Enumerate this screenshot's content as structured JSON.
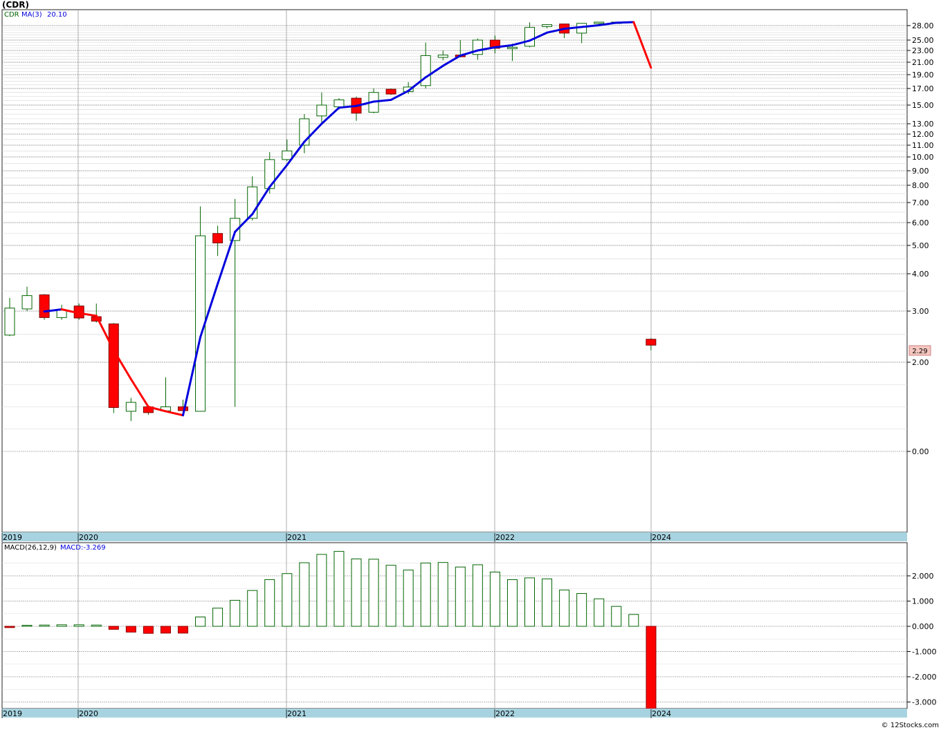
{
  "symbol_label": "(CDR)",
  "price_panel": {
    "legend_symbol": "CDR",
    "legend_ma": "MA(3)",
    "legend_ma_value": "20.10",
    "last_price_tag": "2.29"
  },
  "macd_panel": {
    "legend_label": "MACD(26,12,9)",
    "legend_value": "MACD:-3.269"
  },
  "footer": {
    "copyright": "© 12Stocks.com"
  },
  "colors": {
    "up_candle": "#ffffff",
    "up_outline": "#006400",
    "down_candle": "#ff0000",
    "ma_line": "#0000dd",
    "ma_down": "#ff0000",
    "date_bar": "#a7d3e0",
    "grid": "#aaaaaa",
    "price_tag_bg": "#f4c7c0"
  },
  "chart_data": [
    {
      "type": "candlestick",
      "title": "",
      "y_scale": "log",
      "y_ticks": [
        "28.00",
        "25.00",
        "23.00",
        "21.00",
        "19.00",
        "17.00",
        "15.00",
        "13.00",
        "12.00",
        "11.00",
        "10.00",
        "9.00",
        "8.00",
        "7.00",
        "6.00",
        "5.00",
        "4.00",
        "3.00",
        "2.00",
        "0.00"
      ],
      "x_ticks": [
        "2019",
        "2020",
        "2021",
        "2022",
        "2024"
      ],
      "grid": true,
      "legend_position": "top-left",
      "candles": [
        {
          "o": 2.48,
          "h": 3.32,
          "l": 2.46,
          "c": 3.07
        },
        {
          "o": 3.05,
          "h": 3.62,
          "l": 3.0,
          "c": 3.38
        },
        {
          "o": 3.4,
          "h": 3.42,
          "l": 2.8,
          "c": 2.85
        },
        {
          "o": 2.85,
          "h": 3.15,
          "l": 2.8,
          "c": 3.02
        },
        {
          "o": 3.12,
          "h": 3.18,
          "l": 2.8,
          "c": 2.84
        },
        {
          "o": 2.87,
          "h": 3.18,
          "l": 2.74,
          "c": 2.77
        },
        {
          "o": 2.71,
          "h": 2.73,
          "l": 0.86,
          "c": 0.985
        },
        {
          "o": 0.9,
          "h": 1.2,
          "l": 0.68,
          "c": 1.1
        },
        {
          "o": 1.0,
          "h": 1.0,
          "l": 0.82,
          "c": 0.87
        },
        {
          "o": 0.91,
          "h": 1.66,
          "l": 0.89,
          "c": 1.0
        },
        {
          "o": 1.0,
          "h": 1.16,
          "l": 0.88,
          "c": 0.915
        },
        {
          "o": 0.9,
          "h": 6.8,
          "l": 0.895,
          "c": 5.4
        },
        {
          "o": 5.5,
          "h": 5.85,
          "l": 4.6,
          "c": 5.1
        },
        {
          "o": 5.2,
          "h": 7.2,
          "l": 1.0,
          "c": 6.2
        },
        {
          "o": 6.2,
          "h": 8.6,
          "l": 6.1,
          "c": 7.9
        },
        {
          "o": 7.8,
          "h": 10.4,
          "l": 7.5,
          "c": 9.8
        },
        {
          "o": 9.8,
          "h": 11.5,
          "l": 9.7,
          "c": 10.5
        },
        {
          "o": 11.0,
          "h": 14.0,
          "l": 10.3,
          "c": 13.5
        },
        {
          "o": 13.8,
          "h": 16.5,
          "l": 13.1,
          "c": 15.0
        },
        {
          "o": 14.8,
          "h": 15.8,
          "l": 14.5,
          "c": 15.6
        },
        {
          "o": 15.8,
          "h": 16.0,
          "l": 13.3,
          "c": 14.1
        },
        {
          "o": 14.2,
          "h": 17.0,
          "l": 14.1,
          "c": 16.5
        },
        {
          "o": 16.9,
          "h": 17.0,
          "l": 16.2,
          "c": 16.3
        },
        {
          "o": 16.6,
          "h": 17.9,
          "l": 16.3,
          "c": 17.2
        },
        {
          "o": 17.4,
          "h": 24.5,
          "l": 17.0,
          "c": 22.1
        },
        {
          "o": 21.8,
          "h": 23.0,
          "l": 21.3,
          "c": 22.2
        },
        {
          "o": 22.2,
          "h": 25.0,
          "l": 21.8,
          "c": 21.9
        },
        {
          "o": 22.3,
          "h": 25.3,
          "l": 21.4,
          "c": 25.0
        },
        {
          "o": 25.0,
          "h": 25.9,
          "l": 22.5,
          "c": 23.4
        },
        {
          "o": 23.5,
          "h": 24.3,
          "l": 21.2,
          "c": 23.6
        },
        {
          "o": 23.8,
          "h": 29.0,
          "l": 23.6,
          "c": 27.6
        },
        {
          "o": 27.8,
          "h": 28.4,
          "l": 27.4,
          "c": 28.3
        },
        {
          "o": 28.5,
          "h": 28.6,
          "l": 25.4,
          "c": 26.4
        },
        {
          "o": 26.4,
          "h": 28.8,
          "l": 24.4,
          "c": 28.7
        },
        {
          "o": 28.8,
          "h": 29.2,
          "l": 28.4,
          "c": 29.1
        },
        {
          "o": 29.0,
          "h": 29.2,
          "l": 28.8,
          "c": 29.1
        },
        null,
        {
          "o": 2.4,
          "h": 2.42,
          "l": 2.2,
          "c": 2.29
        }
      ],
      "ma3": [
        null,
        null,
        2.99,
        3.04,
        2.95,
        2.89,
        2.2,
        1.62,
        1.0,
        0.9,
        0.81,
        2.44,
        3.7,
        5.57,
        6.4,
        7.9,
        9.4,
        11.3,
        13.0,
        14.7,
        14.9,
        15.4,
        15.6,
        16.7,
        18.6,
        20.4,
        22.1,
        23.0,
        23.6,
        24.0,
        24.9,
        26.5,
        27.3,
        27.7,
        28.1,
        28.9,
        29.1,
        20.1
      ],
      "macd_label": "MACD(26,12,9)",
      "macd_values": [
        -0.05,
        0.04,
        0.05,
        0.06,
        0.06,
        0.05,
        -0.12,
        -0.23,
        -0.28,
        -0.27,
        -0.27,
        0.37,
        0.72,
        1.03,
        1.42,
        1.85,
        2.09,
        2.52,
        2.85,
        2.97,
        2.67,
        2.66,
        2.42,
        2.23,
        2.51,
        2.53,
        2.35,
        2.44,
        2.15,
        1.85,
        1.92,
        1.88,
        1.44,
        1.3,
        1.09,
        0.79,
        0.47,
        -3.269
      ],
      "macd_ticks": [
        "2.000",
        "1.000",
        "0.000",
        "-1.000",
        "-2.000",
        "-3.000"
      ]
    }
  ]
}
